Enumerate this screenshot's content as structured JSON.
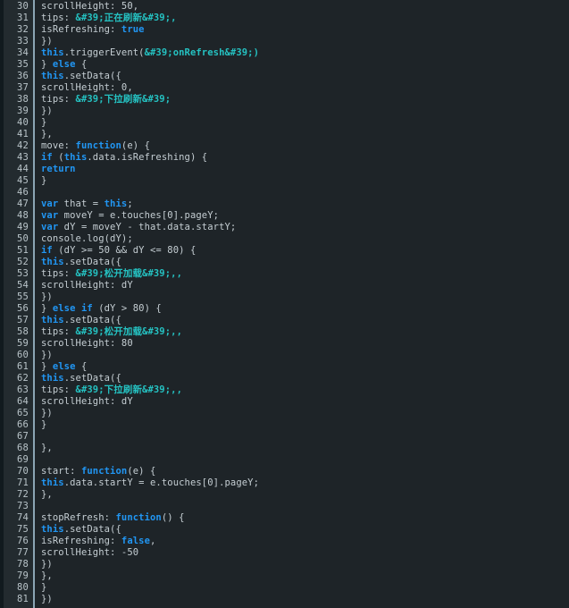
{
  "editor": {
    "theme_name": "dark-code-viewer",
    "colors": {
      "background": "#1e2428",
      "gutter_background": "#232b2f",
      "edge_strip": "#111a1e",
      "divider": "#8ba5b4",
      "text": "#c5ced3",
      "line_number": "#b9c4c9",
      "keyword": "#2196f3",
      "entity_string": "#25c2c2"
    },
    "first_line_number": 30,
    "last_line_number": 81,
    "lines": [
      {
        "n": "30",
        "tokens": [
          {
            "t": "plain",
            "s": "scrollHeight: 50,"
          }
        ]
      },
      {
        "n": "31",
        "tokens": [
          {
            "t": "plain",
            "s": "tips: "
          },
          {
            "t": "ent",
            "s": "&#39;正在刷新&#39;,"
          }
        ]
      },
      {
        "n": "32",
        "tokens": [
          {
            "t": "plain",
            "s": "isRefreshing: "
          },
          {
            "t": "kw",
            "s": "true"
          }
        ]
      },
      {
        "n": "33",
        "tokens": [
          {
            "t": "plain",
            "s": "})"
          }
        ]
      },
      {
        "n": "34",
        "tokens": [
          {
            "t": "kw",
            "s": "this"
          },
          {
            "t": "plain",
            "s": ".triggerEvent("
          },
          {
            "t": "ent",
            "s": "&#39;onRefresh&#39;)"
          }
        ]
      },
      {
        "n": "35",
        "tokens": [
          {
            "t": "plain",
            "s": "} "
          },
          {
            "t": "kw",
            "s": "else"
          },
          {
            "t": "plain",
            "s": " {"
          }
        ]
      },
      {
        "n": "36",
        "tokens": [
          {
            "t": "kw",
            "s": "this"
          },
          {
            "t": "plain",
            "s": ".setData({"
          }
        ]
      },
      {
        "n": "37",
        "tokens": [
          {
            "t": "plain",
            "s": "scrollHeight: 0,"
          }
        ]
      },
      {
        "n": "38",
        "tokens": [
          {
            "t": "plain",
            "s": "tips: "
          },
          {
            "t": "ent",
            "s": "&#39;下拉刷新&#39;"
          }
        ]
      },
      {
        "n": "39",
        "tokens": [
          {
            "t": "plain",
            "s": "})"
          }
        ]
      },
      {
        "n": "40",
        "tokens": [
          {
            "t": "plain",
            "s": "}"
          }
        ]
      },
      {
        "n": "41",
        "tokens": [
          {
            "t": "plain",
            "s": "},"
          }
        ]
      },
      {
        "n": "42",
        "tokens": [
          {
            "t": "plain",
            "s": "move: "
          },
          {
            "t": "kw",
            "s": "function"
          },
          {
            "t": "plain",
            "s": "(e) {"
          }
        ]
      },
      {
        "n": "43",
        "tokens": [
          {
            "t": "kw",
            "s": "if"
          },
          {
            "t": "plain",
            "s": " ("
          },
          {
            "t": "kw",
            "s": "this"
          },
          {
            "t": "plain",
            "s": ".data.isRefreshing) {"
          }
        ]
      },
      {
        "n": "44",
        "tokens": [
          {
            "t": "kw",
            "s": "return"
          }
        ]
      },
      {
        "n": "45",
        "tokens": [
          {
            "t": "plain",
            "s": "}"
          }
        ]
      },
      {
        "n": "46",
        "tokens": [
          {
            "t": "plain",
            "s": ""
          }
        ]
      },
      {
        "n": "47",
        "tokens": [
          {
            "t": "kw",
            "s": "var"
          },
          {
            "t": "plain",
            "s": " that = "
          },
          {
            "t": "kw",
            "s": "this"
          },
          {
            "t": "plain",
            "s": ";"
          }
        ]
      },
      {
        "n": "48",
        "tokens": [
          {
            "t": "kw",
            "s": "var"
          },
          {
            "t": "plain",
            "s": " moveY = e.touches[0].pageY;"
          }
        ]
      },
      {
        "n": "49",
        "tokens": [
          {
            "t": "kw",
            "s": "var"
          },
          {
            "t": "plain",
            "s": " dY = moveY - that.data.startY;"
          }
        ]
      },
      {
        "n": "50",
        "tokens": [
          {
            "t": "plain",
            "s": "console.log(dY);"
          }
        ]
      },
      {
        "n": "51",
        "tokens": [
          {
            "t": "kw",
            "s": "if"
          },
          {
            "t": "plain",
            "s": " (dY >= 50 && dY <= 80) {"
          }
        ]
      },
      {
        "n": "52",
        "tokens": [
          {
            "t": "kw",
            "s": "this"
          },
          {
            "t": "plain",
            "s": ".setData({"
          }
        ]
      },
      {
        "n": "53",
        "tokens": [
          {
            "t": "plain",
            "s": "tips: "
          },
          {
            "t": "ent",
            "s": "&#39;松开加载&#39;,,"
          }
        ]
      },
      {
        "n": "54",
        "tokens": [
          {
            "t": "plain",
            "s": "scrollHeight: dY"
          }
        ]
      },
      {
        "n": "55",
        "tokens": [
          {
            "t": "plain",
            "s": "})"
          }
        ]
      },
      {
        "n": "56",
        "tokens": [
          {
            "t": "plain",
            "s": "} "
          },
          {
            "t": "kw",
            "s": "else"
          },
          {
            "t": "plain",
            "s": " "
          },
          {
            "t": "kw",
            "s": "if"
          },
          {
            "t": "plain",
            "s": " (dY > 80) {"
          }
        ]
      },
      {
        "n": "57",
        "tokens": [
          {
            "t": "kw",
            "s": "this"
          },
          {
            "t": "plain",
            "s": ".setData({"
          }
        ]
      },
      {
        "n": "58",
        "tokens": [
          {
            "t": "plain",
            "s": "tips: "
          },
          {
            "t": "ent",
            "s": "&#39;松开加载&#39;,,"
          }
        ]
      },
      {
        "n": "59",
        "tokens": [
          {
            "t": "plain",
            "s": "scrollHeight: 80"
          }
        ]
      },
      {
        "n": "60",
        "tokens": [
          {
            "t": "plain",
            "s": "})"
          }
        ]
      },
      {
        "n": "61",
        "tokens": [
          {
            "t": "plain",
            "s": "} "
          },
          {
            "t": "kw",
            "s": "else"
          },
          {
            "t": "plain",
            "s": " {"
          }
        ]
      },
      {
        "n": "62",
        "tokens": [
          {
            "t": "kw",
            "s": "this"
          },
          {
            "t": "plain",
            "s": ".setData({"
          }
        ]
      },
      {
        "n": "63",
        "tokens": [
          {
            "t": "plain",
            "s": "tips: "
          },
          {
            "t": "ent",
            "s": "&#39;下拉刷新&#39;,,"
          }
        ]
      },
      {
        "n": "64",
        "tokens": [
          {
            "t": "plain",
            "s": "scrollHeight: dY"
          }
        ]
      },
      {
        "n": "65",
        "tokens": [
          {
            "t": "plain",
            "s": "})"
          }
        ]
      },
      {
        "n": "66",
        "tokens": [
          {
            "t": "plain",
            "s": "}"
          }
        ]
      },
      {
        "n": "67",
        "tokens": [
          {
            "t": "plain",
            "s": ""
          }
        ]
      },
      {
        "n": "68",
        "tokens": [
          {
            "t": "plain",
            "s": "},"
          }
        ]
      },
      {
        "n": "69",
        "tokens": [
          {
            "t": "plain",
            "s": ""
          }
        ]
      },
      {
        "n": "70",
        "tokens": [
          {
            "t": "plain",
            "s": "start: "
          },
          {
            "t": "kw",
            "s": "function"
          },
          {
            "t": "plain",
            "s": "(e) {"
          }
        ]
      },
      {
        "n": "71",
        "tokens": [
          {
            "t": "kw",
            "s": "this"
          },
          {
            "t": "plain",
            "s": ".data.startY = e.touches[0].pageY;"
          }
        ]
      },
      {
        "n": "72",
        "tokens": [
          {
            "t": "plain",
            "s": "},"
          }
        ]
      },
      {
        "n": "73",
        "tokens": [
          {
            "t": "plain",
            "s": ""
          }
        ]
      },
      {
        "n": "74",
        "tokens": [
          {
            "t": "plain",
            "s": "stopRefresh: "
          },
          {
            "t": "kw",
            "s": "function"
          },
          {
            "t": "plain",
            "s": "() {"
          }
        ]
      },
      {
        "n": "75",
        "tokens": [
          {
            "t": "kw",
            "s": "this"
          },
          {
            "t": "plain",
            "s": ".setData({"
          }
        ]
      },
      {
        "n": "76",
        "tokens": [
          {
            "t": "plain",
            "s": "isRefreshing: "
          },
          {
            "t": "kw",
            "s": "false"
          },
          {
            "t": "plain",
            "s": ","
          }
        ]
      },
      {
        "n": "77",
        "tokens": [
          {
            "t": "plain",
            "s": "scrollHeight: -50"
          }
        ]
      },
      {
        "n": "78",
        "tokens": [
          {
            "t": "plain",
            "s": "})"
          }
        ]
      },
      {
        "n": "79",
        "tokens": [
          {
            "t": "plain",
            "s": "},"
          }
        ]
      },
      {
        "n": "80",
        "tokens": [
          {
            "t": "plain",
            "s": "}"
          }
        ]
      },
      {
        "n": "81",
        "tokens": [
          {
            "t": "plain",
            "s": "})"
          }
        ]
      }
    ]
  }
}
